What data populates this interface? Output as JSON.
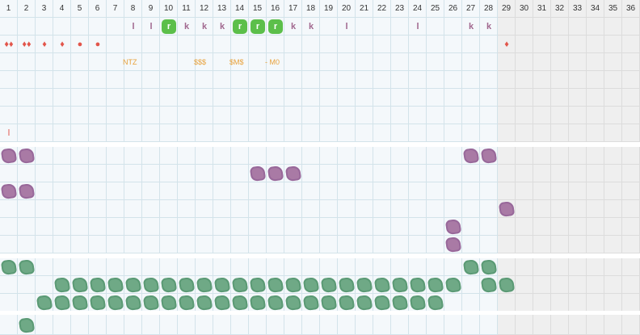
{
  "columns": [
    "1",
    "2",
    "3",
    "4",
    "5",
    "6",
    "7",
    "8",
    "9",
    "10",
    "11",
    "12",
    "13",
    "14",
    "15",
    "16",
    "17",
    "18",
    "19",
    "20",
    "21",
    "22",
    "23",
    "24",
    "25",
    "26",
    "27",
    "28",
    "29",
    "30",
    "31",
    "32",
    "33",
    "34",
    "35",
    "36"
  ],
  "greyed_from_column": 29,
  "colors": {
    "purple": "#a97aa5",
    "green": "#6fa986",
    "badge": "#5cbf4a",
    "drop": "#e2554a",
    "note": "#e8a13a",
    "letter": "#a1688f"
  },
  "letters_row": [
    {
      "col": 8,
      "text": "l",
      "badge": false
    },
    {
      "col": 9,
      "text": "l",
      "badge": false
    },
    {
      "col": 10,
      "text": "r",
      "badge": true
    },
    {
      "col": 11,
      "text": "k",
      "badge": false
    },
    {
      "col": 12,
      "text": "k",
      "badge": false
    },
    {
      "col": 13,
      "text": "k",
      "badge": false
    },
    {
      "col": 14,
      "text": "r",
      "badge": true
    },
    {
      "col": 15,
      "text": "r",
      "badge": true
    },
    {
      "col": 16,
      "text": "r",
      "badge": true
    },
    {
      "col": 17,
      "text": "k",
      "badge": false
    },
    {
      "col": 18,
      "text": "k",
      "badge": false
    },
    {
      "col": 20,
      "text": "l",
      "badge": false
    },
    {
      "col": 24,
      "text": "l",
      "badge": false
    },
    {
      "col": 27,
      "text": "k",
      "badge": false
    },
    {
      "col": 28,
      "text": "k",
      "badge": false
    }
  ],
  "drops_row": [
    {
      "col": 1,
      "text": "♦♦"
    },
    {
      "col": 2,
      "text": "♦♦"
    },
    {
      "col": 3,
      "text": "♦"
    },
    {
      "col": 4,
      "text": "♦"
    },
    {
      "col": 5,
      "text": "●"
    },
    {
      "col": 6,
      "text": "●"
    },
    {
      "col": 29,
      "text": "♦"
    }
  ],
  "notes_row": [
    {
      "col": 8,
      "text": "NTZ"
    },
    {
      "col": 12,
      "text": "$$$"
    },
    {
      "col": 14,
      "text": "$M$"
    },
    {
      "col": 16,
      "text": "- M0"
    }
  ],
  "misc_marks": [
    {
      "col": 1,
      "row": 7,
      "text": "l"
    }
  ],
  "purple_blobs": [
    {
      "col": 1,
      "row": 0
    },
    {
      "col": 2,
      "row": 0
    },
    {
      "col": 27,
      "row": 0
    },
    {
      "col": 28,
      "row": 0
    },
    {
      "col": 15,
      "row": 1
    },
    {
      "col": 16,
      "row": 1
    },
    {
      "col": 17,
      "row": 1
    },
    {
      "col": 1,
      "row": 2
    },
    {
      "col": 2,
      "row": 2
    },
    {
      "col": 29,
      "row": 3
    },
    {
      "col": 26,
      "row": 4
    },
    {
      "col": 26,
      "row": 5
    }
  ],
  "green_blobs_row0": [
    1,
    2,
    27,
    28
  ],
  "green_blobs_row1": [
    4,
    5,
    6,
    7,
    8,
    9,
    10,
    11,
    12,
    13,
    14,
    15,
    16,
    17,
    18,
    19,
    20,
    21,
    22,
    23,
    24,
    25,
    26,
    28,
    29
  ],
  "green_blobs_row2": [
    3,
    4,
    5,
    6,
    7,
    8,
    9,
    10,
    11,
    12,
    13,
    14,
    15,
    16,
    17,
    18,
    19,
    20,
    21,
    22,
    23,
    24,
    25
  ],
  "green_blobs_row_last": [
    2
  ]
}
